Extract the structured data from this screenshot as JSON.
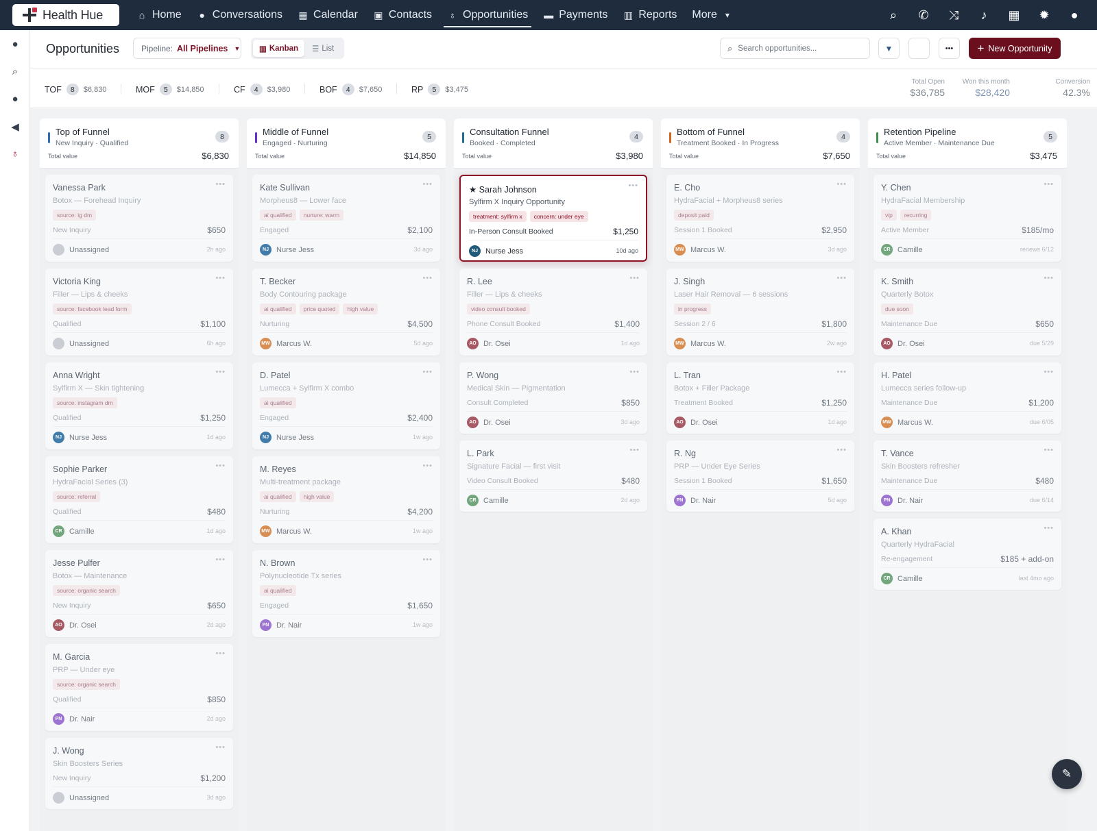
{
  "brand": {
    "name": "Health Hue"
  },
  "nav": {
    "items": [
      {
        "label": "Home",
        "icon": "home-icon",
        "glyph": "⌂"
      },
      {
        "label": "Conversations",
        "icon": "chat-icon",
        "glyph": "●"
      },
      {
        "label": "Calendar",
        "icon": "calendar-icon",
        "glyph": "▦"
      },
      {
        "label": "Contacts",
        "icon": "contact-card-icon",
        "glyph": "▣"
      },
      {
        "label": "Opportunities",
        "icon": "lightbulb-icon",
        "glyph": "♁",
        "active": true
      },
      {
        "label": "Payments",
        "icon": "card-icon",
        "glyph": "▬"
      },
      {
        "label": "Reports",
        "icon": "bar-chart-icon",
        "glyph": "▥"
      },
      {
        "label": "More",
        "icon": "chevron-down-icon",
        "glyph": "▾"
      }
    ],
    "right_icons": [
      {
        "name": "search-icon",
        "glyph": "⌕"
      },
      {
        "name": "phone-icon",
        "glyph": "✆"
      },
      {
        "name": "shuffle-icon",
        "glyph": "⤨"
      },
      {
        "name": "bell-icon",
        "glyph": "♪"
      },
      {
        "name": "calendar-icon",
        "glyph": "▦"
      },
      {
        "name": "gear-icon",
        "glyph": "✹"
      },
      {
        "name": "user-icon",
        "glyph": "●"
      }
    ]
  },
  "rail": [
    {
      "name": "chat-icon",
      "glyph": "●"
    },
    {
      "name": "search-icon",
      "glyph": "⌕"
    },
    {
      "name": "user-icon",
      "glyph": "●"
    },
    {
      "name": "megaphone-icon",
      "glyph": "◀"
    },
    {
      "name": "lightbulb-icon",
      "glyph": "♁",
      "color": "#b3122b"
    }
  ],
  "header": {
    "title": "Opportunities",
    "pipeline_label": "Pipeline:",
    "pipeline_value": "All Pipelines",
    "view_kanban": "Kanban",
    "view_list": "List",
    "search_placeholder": "Search opportunities...",
    "new_button": "New Opportunity"
  },
  "stats": {
    "stages": [
      {
        "name": "TOF",
        "count": "8",
        "value": "$6,830"
      },
      {
        "name": "MOF",
        "count": "5",
        "value": "$14,850"
      },
      {
        "name": "CF",
        "count": "4",
        "value": "$3,980"
      },
      {
        "name": "BOF",
        "count": "4",
        "value": "$7,650"
      },
      {
        "name": "RP",
        "count": "5",
        "value": "$3,475"
      }
    ],
    "kpis": [
      {
        "label": "Total Open",
        "value": "$36,785",
        "accent": false
      },
      {
        "label": "Won this month",
        "value": "$28,420",
        "accent": true
      },
      {
        "label": "Conversion",
        "value": "42.3%",
        "accent": false
      }
    ]
  },
  "total_value_label": "Total value",
  "columns": [
    {
      "title": "Top of Funnel",
      "subtitle": "New Inquiry · Qualified",
      "count": "8",
      "total": "$6,830",
      "color": "#2f6fb3",
      "cards": [
        {
          "name": "Vanessa Park",
          "sub": "Botox — Forehead Inquiry",
          "tags": [
            "source: ig dm"
          ],
          "status": "New Inquiry",
          "amount": "$650",
          "owner": "Unassigned",
          "initials": "",
          "avatar": "#c9cdd3",
          "time": "2h ago"
        },
        {
          "name": "Victoria King",
          "sub": "Filler — Lips & cheeks",
          "tags": [
            "source: facebook lead form"
          ],
          "status": "Qualified",
          "amount": "$1,100",
          "owner": "Unassigned",
          "initials": "",
          "avatar": "#c9cdd3",
          "time": "6h ago"
        },
        {
          "name": "Anna Wright",
          "sub": "Sylfirm X — Skin tightening",
          "tags": [
            "source: instagram dm"
          ],
          "status": "Qualified",
          "amount": "$1,250",
          "owner": "Nurse Jess",
          "initials": "NJ",
          "avatar": "#3b78a8",
          "time": "1d ago"
        },
        {
          "name": "Sophie Parker",
          "sub": "HydraFacial Series (3)",
          "tags": [
            "source: referral"
          ],
          "status": "Qualified",
          "amount": "$480",
          "owner": "Camille",
          "initials": "CR",
          "avatar": "#6fa379",
          "time": "1d ago"
        },
        {
          "name": "Jesse Pulfer",
          "sub": "Botox — Maintenance",
          "tags": [
            "source: organic search"
          ],
          "status": "New Inquiry",
          "amount": "$650",
          "owner": "Dr. Osei",
          "initials": "AO",
          "avatar": "#a5535f",
          "time": "2d ago"
        },
        {
          "name": "M. Garcia",
          "sub": "PRP — Under eye",
          "tags": [
            "source: organic search"
          ],
          "status": "Qualified",
          "amount": "$850",
          "owner": "Dr. Nair",
          "initials": "PN",
          "avatar": "#9a6fd0",
          "time": "2d ago"
        },
        {
          "name": "J. Wong",
          "sub": "Skin Boosters Series",
          "tags": [],
          "status": "New Inquiry",
          "amount": "$1,200",
          "owner": "Unassigned",
          "initials": "",
          "avatar": "#c9cdd3",
          "time": "3d ago"
        }
      ]
    },
    {
      "title": "Middle of Funnel",
      "subtitle": "Engaged · Nurturing",
      "count": "5",
      "total": "$14,850",
      "color": "#6b2fd1",
      "cards": [
        {
          "name": "Kate Sullivan",
          "sub": "Morpheus8 — Lower face",
          "tags": [
            "ai qualified",
            "nurture: warm"
          ],
          "status": "Engaged",
          "amount": "$2,100",
          "owner": "Nurse Jess",
          "initials": "NJ",
          "avatar": "#3b78a8",
          "time": "3d ago"
        },
        {
          "name": "T. Becker",
          "sub": "Body Contouring package",
          "tags": [
            "ai qualified",
            "price quoted",
            "high value"
          ],
          "status": "Nurturing",
          "amount": "$4,500",
          "owner": "Marcus W.",
          "initials": "MW",
          "avatar": "#d88b4c",
          "time": "5d ago"
        },
        {
          "name": "D. Patel",
          "sub": "Lumecca + Sylfirm X combo",
          "tags": [
            "ai qualified"
          ],
          "status": "Engaged",
          "amount": "$2,400",
          "owner": "Nurse Jess",
          "initials": "NJ",
          "avatar": "#3b78a8",
          "time": "1w ago"
        },
        {
          "name": "M. Reyes",
          "sub": "Multi-treatment package",
          "tags": [
            "ai qualified",
            "high value"
          ],
          "status": "Nurturing",
          "amount": "$4,200",
          "owner": "Marcus W.",
          "initials": "MW",
          "avatar": "#d88b4c",
          "time": "1w ago"
        },
        {
          "name": "N. Brown",
          "sub": "Polynucleotide Tx series",
          "tags": [
            "ai qualified"
          ],
          "status": "Engaged",
          "amount": "$1,650",
          "owner": "Dr. Nair",
          "initials": "PN",
          "avatar": "#9a6fd0",
          "time": "1w ago"
        }
      ]
    },
    {
      "title": "Consultation Funnel",
      "subtitle": "Booked · Completed",
      "count": "4",
      "total": "$3,980",
      "color": "#1f6e8c",
      "cards": [
        {
          "name": "★ Sarah Johnson",
          "sub": "Sylfirm X Inquiry Opportunity",
          "tags": [
            "treatment: sylfirm x",
            "concern: under eye"
          ],
          "status": "In-Person Consult Booked",
          "amount": "$1,250",
          "owner": "Nurse Jess",
          "initials": "NJ",
          "avatar": "#1f5a7a",
          "time": "10d ago",
          "highlight": true
        },
        {
          "name": "R. Lee",
          "sub": "Filler — Lips & cheeks",
          "tags": [
            "video consult booked"
          ],
          "status": "Phone Consult Booked",
          "amount": "$1,400",
          "owner": "Dr. Osei",
          "initials": "AO",
          "avatar": "#a5535f",
          "time": "1d ago"
        },
        {
          "name": "P. Wong",
          "sub": "Medical Skin — Pigmentation",
          "tags": [],
          "status": "Consult Completed",
          "amount": "$850",
          "owner": "Dr. Osei",
          "initials": "AO",
          "avatar": "#a5535f",
          "time": "3d ago"
        },
        {
          "name": "L. Park",
          "sub": "Signature Facial — first visit",
          "tags": [],
          "status": "Video Consult Booked",
          "amount": "$480",
          "owner": "Camille",
          "initials": "CR",
          "avatar": "#6fa379",
          "time": "2d ago"
        }
      ]
    },
    {
      "title": "Bottom of Funnel",
      "subtitle": "Treatment Booked · In Progress",
      "count": "4",
      "total": "$7,650",
      "color": "#d2691e",
      "cards": [
        {
          "name": "E. Cho",
          "sub": "HydraFacial + Morpheus8 series",
          "tags": [
            "deposit paid"
          ],
          "status": "Session 1 Booked",
          "amount": "$2,950",
          "owner": "Marcus W.",
          "initials": "MW",
          "avatar": "#d88b4c",
          "time": "3d ago"
        },
        {
          "name": "J. Singh",
          "sub": "Laser Hair Removal — 6 sessions",
          "tags": [
            "in progress"
          ],
          "status": "Session 2 / 6",
          "amount": "$1,800",
          "owner": "Marcus W.",
          "initials": "MW",
          "avatar": "#d88b4c",
          "time": "2w ago"
        },
        {
          "name": "L. Tran",
          "sub": "Botox + Filler Package",
          "tags": [],
          "status": "Treatment Booked",
          "amount": "$1,250",
          "owner": "Dr. Osei",
          "initials": "AO",
          "avatar": "#a5535f",
          "time": "1d ago"
        },
        {
          "name": "R. Ng",
          "sub": "PRP — Under Eye Series",
          "tags": [],
          "status": "Session 1 Booked",
          "amount": "$1,650",
          "owner": "Dr. Nair",
          "initials": "PN",
          "avatar": "#9a6fd0",
          "time": "5d ago"
        }
      ]
    },
    {
      "title": "Retention Pipeline",
      "subtitle": "Active Member · Maintenance Due",
      "count": "5",
      "total": "$3,475",
      "color": "#3f8f4a",
      "cards": [
        {
          "name": "Y. Chen",
          "sub": "HydraFacial Membership",
          "tags": [
            "vip",
            "recurring"
          ],
          "status": "Active Member",
          "amount": "$185/mo",
          "owner": "Camille",
          "initials": "CR",
          "avatar": "#6fa379",
          "time": "renews 6/12"
        },
        {
          "name": "K. Smith",
          "sub": "Quarterly Botox",
          "tags": [
            "due soon"
          ],
          "status": "Maintenance Due",
          "amount": "$650",
          "owner": "Dr. Osei",
          "initials": "AO",
          "avatar": "#a5535f",
          "time": "due 5/29"
        },
        {
          "name": "H. Patel",
          "sub": "Lumecca series follow-up",
          "tags": [],
          "status": "Maintenance Due",
          "amount": "$1,200",
          "owner": "Marcus W.",
          "initials": "MW",
          "avatar": "#d88b4c",
          "time": "due 6/05"
        },
        {
          "name": "T. Vance",
          "sub": "Skin Boosters refresher",
          "tags": [],
          "status": "Maintenance Due",
          "amount": "$480",
          "owner": "Dr. Nair",
          "initials": "PN",
          "avatar": "#9a6fd0",
          "time": "due 6/14"
        },
        {
          "name": "A. Khan",
          "sub": "Quarterly HydraFacial",
          "tags": [],
          "status": "Re-engagement",
          "amount": "$185 + add-on",
          "owner": "Camille",
          "initials": "CR",
          "avatar": "#6fa379",
          "time": "last 4mo ago"
        }
      ]
    }
  ],
  "fab": {
    "icon": "magic-wand-icon",
    "glyph": "✎"
  }
}
